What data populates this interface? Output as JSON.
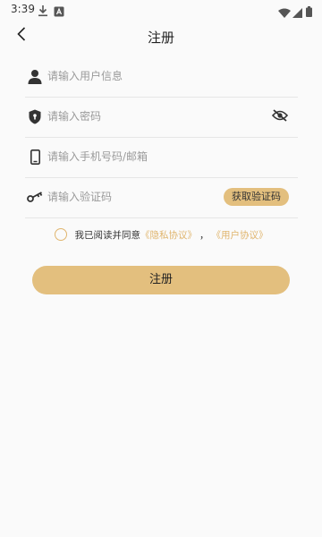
{
  "status_bar": {
    "time": "3:39",
    "icons": [
      "download-icon",
      "app-badge-icon",
      "wifi-icon",
      "signal-icon",
      "battery-icon"
    ]
  },
  "header": {
    "title": "注册",
    "back_icon": "back-arrow-icon"
  },
  "form": {
    "username": {
      "placeholder": "请输入用户信息",
      "icon": "user-icon"
    },
    "password": {
      "placeholder": "请输入密码",
      "icon": "shield-icon",
      "toggle_icon": "eye-off-icon"
    },
    "phone": {
      "placeholder": "请输入手机号码/邮箱",
      "icon": "phone-icon"
    },
    "code": {
      "placeholder": "请输入验证码",
      "icon": "key-icon",
      "button_label": "获取验证码"
    }
  },
  "agreement": {
    "prefix": "我已阅读并同意",
    "privacy_link": "《隐私协议》",
    "separator": "，",
    "user_link": "《用户协议》",
    "checked": false
  },
  "register_button": {
    "label": "注册"
  },
  "colors": {
    "accent": "#e3bf7e",
    "link": "#e0b56e",
    "background": "#fafafa",
    "placeholder": "#9a9a9a"
  }
}
